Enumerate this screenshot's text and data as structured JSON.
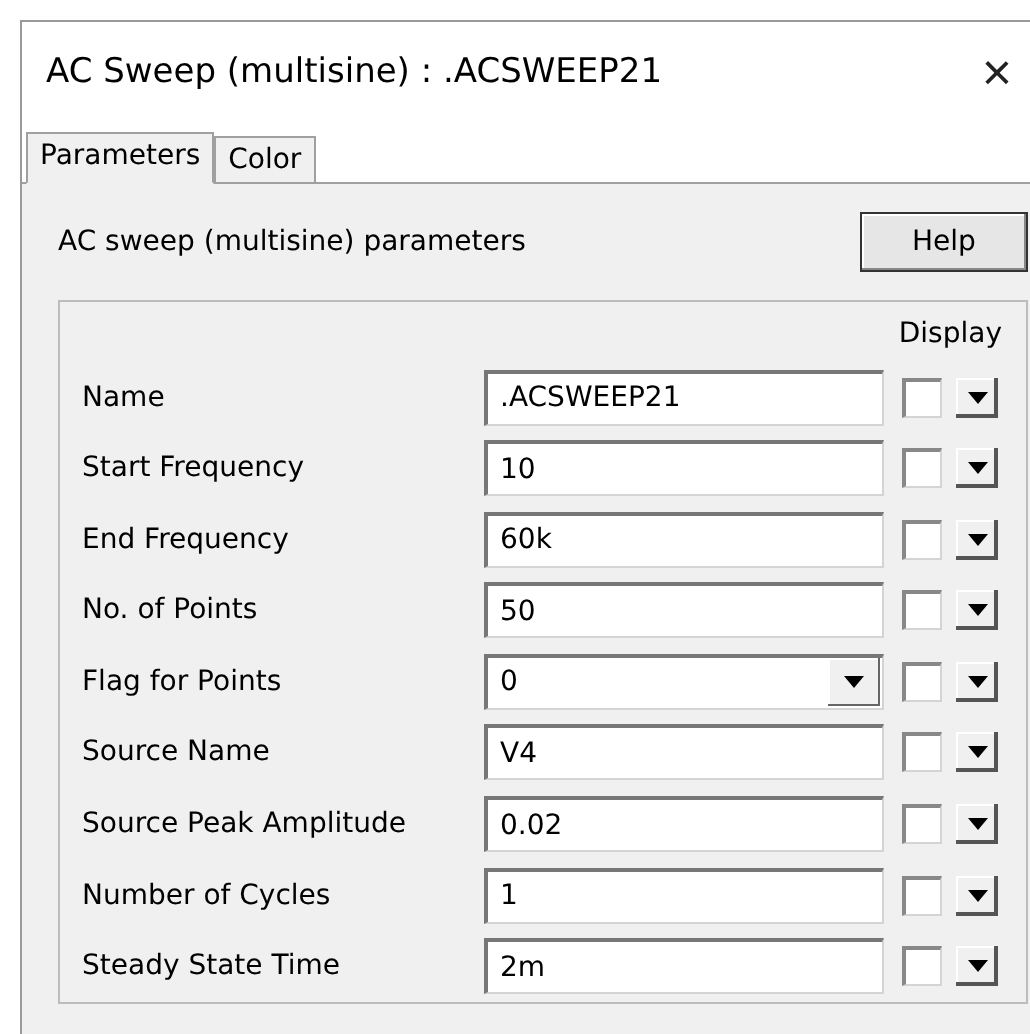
{
  "window": {
    "title": "AC Sweep (multisine) : .ACSWEEP21",
    "close": "×"
  },
  "tabs": [
    {
      "label": "Parameters",
      "selected": true
    },
    {
      "label": "Color",
      "selected": false
    }
  ],
  "heading": "AC sweep (multisine) parameters",
  "help_button": "Help",
  "display_header": "Display",
  "rows": [
    {
      "label": "Name",
      "kind": "text",
      "value": ".ACSWEEP21",
      "display": false
    },
    {
      "label": "Start Frequency",
      "kind": "text",
      "value": "10",
      "display": false
    },
    {
      "label": "End Frequency",
      "kind": "text",
      "value": "60k",
      "display": false
    },
    {
      "label": "No. of Points",
      "kind": "text",
      "value": "50",
      "display": false
    },
    {
      "label": "Flag for Points",
      "kind": "combo",
      "value": "0",
      "display": false
    },
    {
      "label": "Source Name",
      "kind": "text",
      "value": "V4",
      "display": false
    },
    {
      "label": "Source Peak Amplitude",
      "kind": "text",
      "value": "0.02",
      "display": false
    },
    {
      "label": "Number of Cycles",
      "kind": "text",
      "value": "1",
      "display": false
    },
    {
      "label": "Steady State Time",
      "kind": "text",
      "value": "2m",
      "display": false
    }
  ]
}
